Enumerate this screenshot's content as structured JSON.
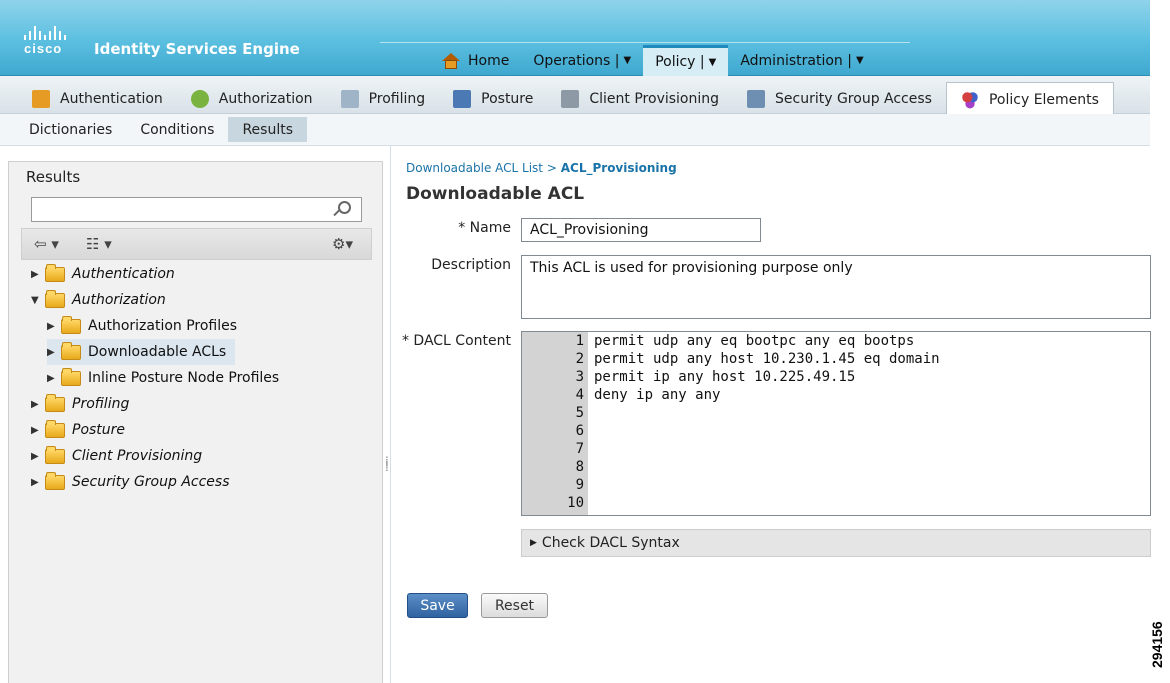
{
  "header": {
    "brand": "cisco",
    "title": "Identity Services Engine",
    "nav": [
      {
        "label": "Home",
        "dropdown": false
      },
      {
        "label": "Operations |",
        "dropdown": true
      },
      {
        "label": "Policy |",
        "dropdown": true,
        "active": true
      },
      {
        "label": "Administration |",
        "dropdown": true
      }
    ]
  },
  "policy_tabs": [
    "Authentication",
    "Authorization",
    "Profiling",
    "Posture",
    "Client Provisioning",
    "Security Group Access",
    "Policy Elements"
  ],
  "sub_tabs": [
    "Dictionaries",
    "Conditions",
    "Results"
  ],
  "left_panel": {
    "title": "Results",
    "search_placeholder": "",
    "tree": [
      {
        "label": "Authentication",
        "italic": true,
        "expanded": false
      },
      {
        "label": "Authorization",
        "italic": true,
        "expanded": true
      },
      {
        "label": "Authorization Profiles",
        "italic": false
      },
      {
        "label": "Downloadable ACLs",
        "italic": false,
        "selected": true
      },
      {
        "label": "Inline Posture Node Profiles",
        "italic": false
      },
      {
        "label": "Profiling",
        "italic": true
      },
      {
        "label": "Posture",
        "italic": true
      },
      {
        "label": "Client Provisioning",
        "italic": true
      },
      {
        "label": "Security Group Access",
        "italic": true
      }
    ]
  },
  "content": {
    "breadcrumb_parent": "Downloadable ACL List",
    "breadcrumb_sep": ">",
    "breadcrumb_current": "ACL_Provisioning",
    "title": "Downloadable ACL",
    "name_label": "* Name",
    "name_value": "ACL_Provisioning",
    "description_label": "Description",
    "description_value": "This ACL is used for provisioning purpose only",
    "dacl_label": "* DACL Content",
    "dacl_lines": [
      "permit udp any eq bootpc any eq bootps",
      "permit udp any host 10.230.1.45 eq domain",
      "permit ip any host 10.225.49.15",
      "deny ip any any",
      "",
      "",
      "",
      "",
      "",
      ""
    ],
    "line_numbers": [
      "1",
      "2",
      "3",
      "4",
      "5",
      "6",
      "7",
      "8",
      "9",
      "10"
    ],
    "check_syntax_label": "Check DACL Syntax",
    "save_label": "Save",
    "reset_label": "Reset"
  },
  "doc_id": "294156"
}
